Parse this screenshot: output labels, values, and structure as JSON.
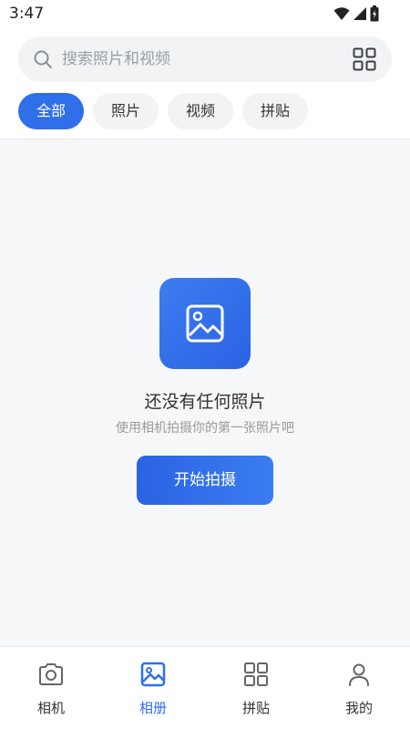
{
  "status_bar": {
    "time": "3:47",
    "icons": [
      "wifi-icon",
      "signal-icon",
      "battery-icon"
    ]
  },
  "search": {
    "placeholder": "搜索照片和视频",
    "icon": "search-icon",
    "grid_icon": "grid-icon"
  },
  "tabs": [
    {
      "label": "全部",
      "active": true
    },
    {
      "label": "照片",
      "active": false
    },
    {
      "label": "视频",
      "active": false
    },
    {
      "label": "拼贴",
      "active": false
    }
  ],
  "empty_state": {
    "icon": "image-icon",
    "title": "还没有任何照片",
    "subtitle": "使用相机拍摄你的第一张照片吧",
    "button_label": "开始拍摄"
  },
  "bottom_nav": [
    {
      "label": "相机",
      "icon": "camera-icon",
      "active": false
    },
    {
      "label": "相册",
      "icon": "album-icon",
      "active": true
    },
    {
      "label": "拼贴",
      "icon": "collage-icon",
      "active": false
    },
    {
      "label": "我的",
      "icon": "profile-icon",
      "active": false
    }
  ],
  "colors": {
    "accent": "#2f6fea",
    "background": "#f6f7f9",
    "tab_inactive": "#f1f3f5"
  }
}
